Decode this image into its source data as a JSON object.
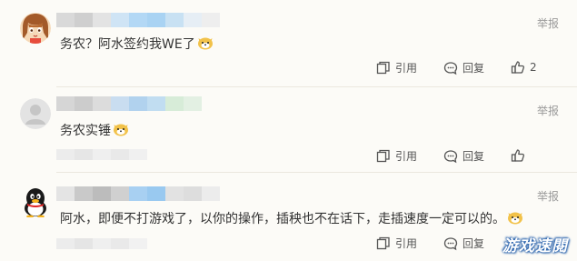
{
  "comments": [
    {
      "avatar": "anime-girl-avatar",
      "text": "务农？阿水签约我WE了",
      "report_label": "举报",
      "quote_label": "引用",
      "reply_label": "回复",
      "like_count": "2"
    },
    {
      "avatar": "default-user-avatar",
      "text": "务农实锤",
      "report_label": "举报",
      "quote_label": "引用",
      "reply_label": "回复",
      "like_count": ""
    },
    {
      "avatar": "qq-penguin-avatar",
      "text": "阿水，即便不打游戏了，以你的操作，插秧也不在话下，走插速度一定可以的。",
      "report_label": "举报",
      "quote_label": "引用",
      "reply_label": "回复",
      "like_count": ""
    }
  ],
  "watermark": "游戏速閱",
  "colors": {
    "background": "#fcfbf7",
    "text": "#333333",
    "muted": "#9a9a9a",
    "watermark_outline": "#1e5aa8"
  }
}
